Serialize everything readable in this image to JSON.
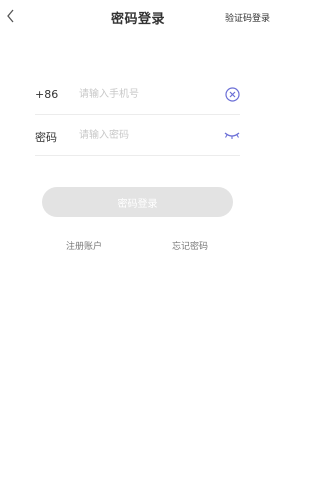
{
  "header": {
    "title": "密码登录",
    "switch_label": "验证码登录"
  },
  "phone_row": {
    "prefix": "+86",
    "placeholder": "请输入手机号",
    "value": ""
  },
  "password_row": {
    "label": "密码",
    "placeholder": "请输入密码",
    "value": ""
  },
  "login_button": {
    "label": "密码登录"
  },
  "links": {
    "register": "注册账户",
    "forgot": "忘记密码"
  },
  "icons": {
    "back": "chevron-left-icon",
    "clear": "clear-circle-icon",
    "password_visibility": "eye-closed-icon"
  },
  "colors": {
    "accent": "#6b6fd6",
    "button_disabled": "#e3e3e3",
    "placeholder": "#c8c8c8",
    "divider": "#ececec"
  }
}
